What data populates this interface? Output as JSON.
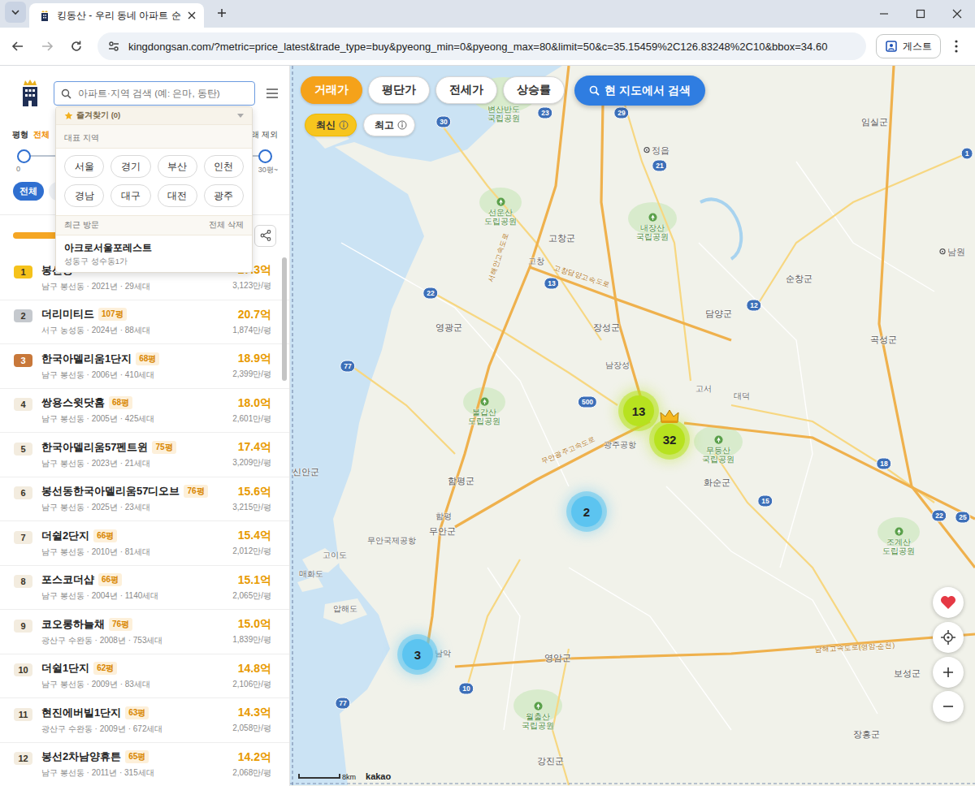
{
  "browser": {
    "tabs": [
      {
        "label": "킹동산 - 우리 동네 아파트 순",
        "selected": true
      }
    ],
    "url": "kingdongsan.com/?metric=price_latest&trade_type=buy&pyeong_min=0&pyeong_max=80&limit=50&c=35.15459%2C126.83248%2C10&bbox=34.60",
    "profile": "게스트"
  },
  "sidebar": {
    "search": {
      "placeholder": "아파트·지역 검색 (예: 은마, 동탄)"
    },
    "filter": {
      "label": "평형",
      "value": "전체",
      "right_label": "래 제외",
      "slider": {
        "low": 0,
        "high": 1,
        "min_label": "0",
        "max_label": "30평~"
      },
      "chips": [
        {
          "label": "전체",
          "selected": true
        },
        {
          "label": "평",
          "selected": false
        }
      ]
    },
    "list": [
      {
        "rank": "1",
        "color": "#f5c21b",
        "name": "봉선동",
        "price": "27.3억",
        "per_pyeong": "3,123만/평",
        "info": "남구 봉선동 · 2021년 · 29세대"
      },
      {
        "rank": "2",
        "color": "#c5c9ce",
        "name": "더리미티드",
        "pyeong": "107평",
        "price": "20.7억",
        "per_pyeong": "1,874만/평",
        "info": "서구 농성동 · 2024년 · 88세대"
      },
      {
        "rank": "3",
        "color": "#c8783a",
        "name": "한국아델리움1단지",
        "pyeong": "68평",
        "price": "18.9억",
        "per_pyeong": "2,399만/평",
        "info": "남구 봉선동 · 2006년 · 410세대"
      },
      {
        "rank": "4",
        "color": "#f3ecdf",
        "name": "쌍용스윗닷홈",
        "pyeong": "68평",
        "price": "18.0억",
        "per_pyeong": "2,601만/평",
        "info": "남구 봉선동 · 2005년 · 425세대"
      },
      {
        "rank": "5",
        "color": "#f3ecdf",
        "name": "한국아델리움57펜트윈",
        "pyeong": "75평",
        "price": "17.4억",
        "per_pyeong": "3,209만/평",
        "info": "남구 봉선동 · 2023년 · 21세대"
      },
      {
        "rank": "6",
        "color": "#f3ecdf",
        "name": "봉선동한국아델리움57디오브",
        "pyeong": "76평",
        "price": "15.6억",
        "per_pyeong": "3,215만/평",
        "info": "남구 봉선동 · 2025년 · 23세대"
      },
      {
        "rank": "7",
        "color": "#f3ecdf",
        "name": "더쉴2단지",
        "pyeong": "66평",
        "price": "15.4억",
        "per_pyeong": "2,012만/평",
        "info": "남구 봉선동 · 2010년 · 81세대"
      },
      {
        "rank": "8",
        "color": "#f3ecdf",
        "name": "포스코더샵",
        "pyeong": "66평",
        "price": "15.1억",
        "per_pyeong": "2,065만/평",
        "info": "남구 봉선동 · 2004년 · 1140세대"
      },
      {
        "rank": "9",
        "color": "#f3ecdf",
        "name": "코오롱하늘채",
        "pyeong": "76평",
        "price": "15.0억",
        "per_pyeong": "1,839만/평",
        "info": "광산구 수완동 · 2008년 · 753세대"
      },
      {
        "rank": "10",
        "color": "#f3ecdf",
        "name": "더쉴1단지",
        "pyeong": "62평",
        "price": "14.8억",
        "per_pyeong": "2,106만/평",
        "info": "남구 봉선동 · 2009년 · 83세대"
      },
      {
        "rank": "11",
        "color": "#f3ecdf",
        "name": "현진에버빌1단지",
        "pyeong": "63평",
        "price": "14.3억",
        "per_pyeong": "2,058만/평",
        "info": "광산구 수완동 · 2009년 · 672세대"
      },
      {
        "rank": "12",
        "color": "#f3ecdf",
        "name": "봉선2차남양휴튼",
        "pyeong": "65평",
        "price": "14.2억",
        "per_pyeong": "2,068만/평",
        "info": "남구 봉선동 · 2011년 · 315세대"
      }
    ]
  },
  "search_dropdown": {
    "favorites": "즐겨찾기 (0)",
    "regions_title": "대표 지역",
    "regions": [
      "서울",
      "경기",
      "부산",
      "인천",
      "경남",
      "대구",
      "대전",
      "광주"
    ],
    "recent_title": "최근 방문",
    "clear_all": "전체 삭제",
    "recent": [
      {
        "name": "아크로서울포레스트",
        "area": "성동구 성수동1가"
      }
    ]
  },
  "map": {
    "metrics": [
      {
        "label": "거래가",
        "selected": true
      },
      {
        "label": "평단가",
        "selected": false
      },
      {
        "label": "전세가",
        "selected": false
      },
      {
        "label": "상승률",
        "selected": false
      }
    ],
    "sorts": [
      {
        "label": "최신",
        "selected": true
      },
      {
        "label": "최고",
        "selected": false
      }
    ],
    "search_button": "현 지도에서 검색",
    "clusters": [
      {
        "count": "13",
        "color": "#b7e21f",
        "crowned": false
      },
      {
        "count": "32",
        "color": "#b7e21f",
        "crowned": true
      },
      {
        "count": "2",
        "color": "#5cc4f0",
        "crowned": false
      },
      {
        "count": "3",
        "color": "#5cc4f0",
        "crowned": false
      }
    ],
    "places": [
      {
        "lines": [
          "변산반도",
          "국립공원"
        ],
        "kind": "parklabel"
      },
      {
        "lines": [
          "정읍"
        ],
        "kind": "town"
      },
      {
        "lines": [
          "임실군"
        ],
        "kind": "region"
      },
      {
        "lines": [
          "선운산",
          "도립공원"
        ],
        "kind": "park"
      },
      {
        "lines": [
          "내장산",
          "국립공원"
        ],
        "kind": "park"
      },
      {
        "lines": [
          "고창군"
        ],
        "kind": "region"
      },
      {
        "lines": [
          "고창"
        ],
        "kind": "small"
      },
      {
        "lines": [
          "남원"
        ],
        "kind": "town"
      },
      {
        "lines": [
          "순창군"
        ],
        "kind": "region"
      },
      {
        "lines": [
          "담양군"
        ],
        "kind": "region"
      },
      {
        "lines": [
          "영광군"
        ],
        "kind": "region"
      },
      {
        "lines": [
          "장성군"
        ],
        "kind": "region"
      },
      {
        "lines": [
          "곡성군"
        ],
        "kind": "region"
      },
      {
        "lines": [
          "남장성"
        ],
        "kind": "small"
      },
      {
        "lines": [
          "고서"
        ],
        "kind": "small"
      },
      {
        "lines": [
          "대덕"
        ],
        "kind": "small"
      },
      {
        "lines": [
          "불갑산",
          "도립공원"
        ],
        "kind": "park"
      },
      {
        "lines": [
          "광주공항"
        ],
        "kind": "small"
      },
      {
        "lines": [
          "무등산",
          "국립공원"
        ],
        "kind": "park"
      },
      {
        "lines": [
          "화순군"
        ],
        "kind": "region"
      },
      {
        "lines": [
          "함평군"
        ],
        "kind": "region"
      },
      {
        "lines": [
          "함평"
        ],
        "kind": "small"
      },
      {
        "lines": [
          "무안군"
        ],
        "kind": "region"
      },
      {
        "lines": [
          "무안국제공항"
        ],
        "kind": "small"
      },
      {
        "lines": [
          "신안군"
        ],
        "kind": "region"
      },
      {
        "lines": [
          "고이도"
        ],
        "kind": "small"
      },
      {
        "lines": [
          "매화도"
        ],
        "kind": "small"
      },
      {
        "lines": [
          "압해도"
        ],
        "kind": "small"
      },
      {
        "lines": [
          "남악"
        ],
        "kind": "small"
      },
      {
        "lines": [
          "영암군"
        ],
        "kind": "region"
      },
      {
        "lines": [
          "월출산",
          "국립공원"
        ],
        "kind": "park"
      },
      {
        "lines": [
          "보성군"
        ],
        "kind": "region"
      },
      {
        "lines": [
          "조계산",
          "도립공원"
        ],
        "kind": "park"
      },
      {
        "lines": [
          "장흥군"
        ],
        "kind": "region"
      },
      {
        "lines": [
          "강진군"
        ],
        "kind": "region"
      }
    ],
    "roads": [
      "30",
      "23",
      "29",
      "21",
      "22",
      "13",
      "12",
      "77",
      "500",
      "15",
      "18",
      "22",
      "25",
      "10",
      "77",
      "1"
    ],
    "highways": [
      "서해안고속도로",
      "고창담양고속도로",
      "무안광주고속도로",
      "남해고속도로(영암-순천)"
    ],
    "scale": "8km",
    "brand": "kakao"
  }
}
